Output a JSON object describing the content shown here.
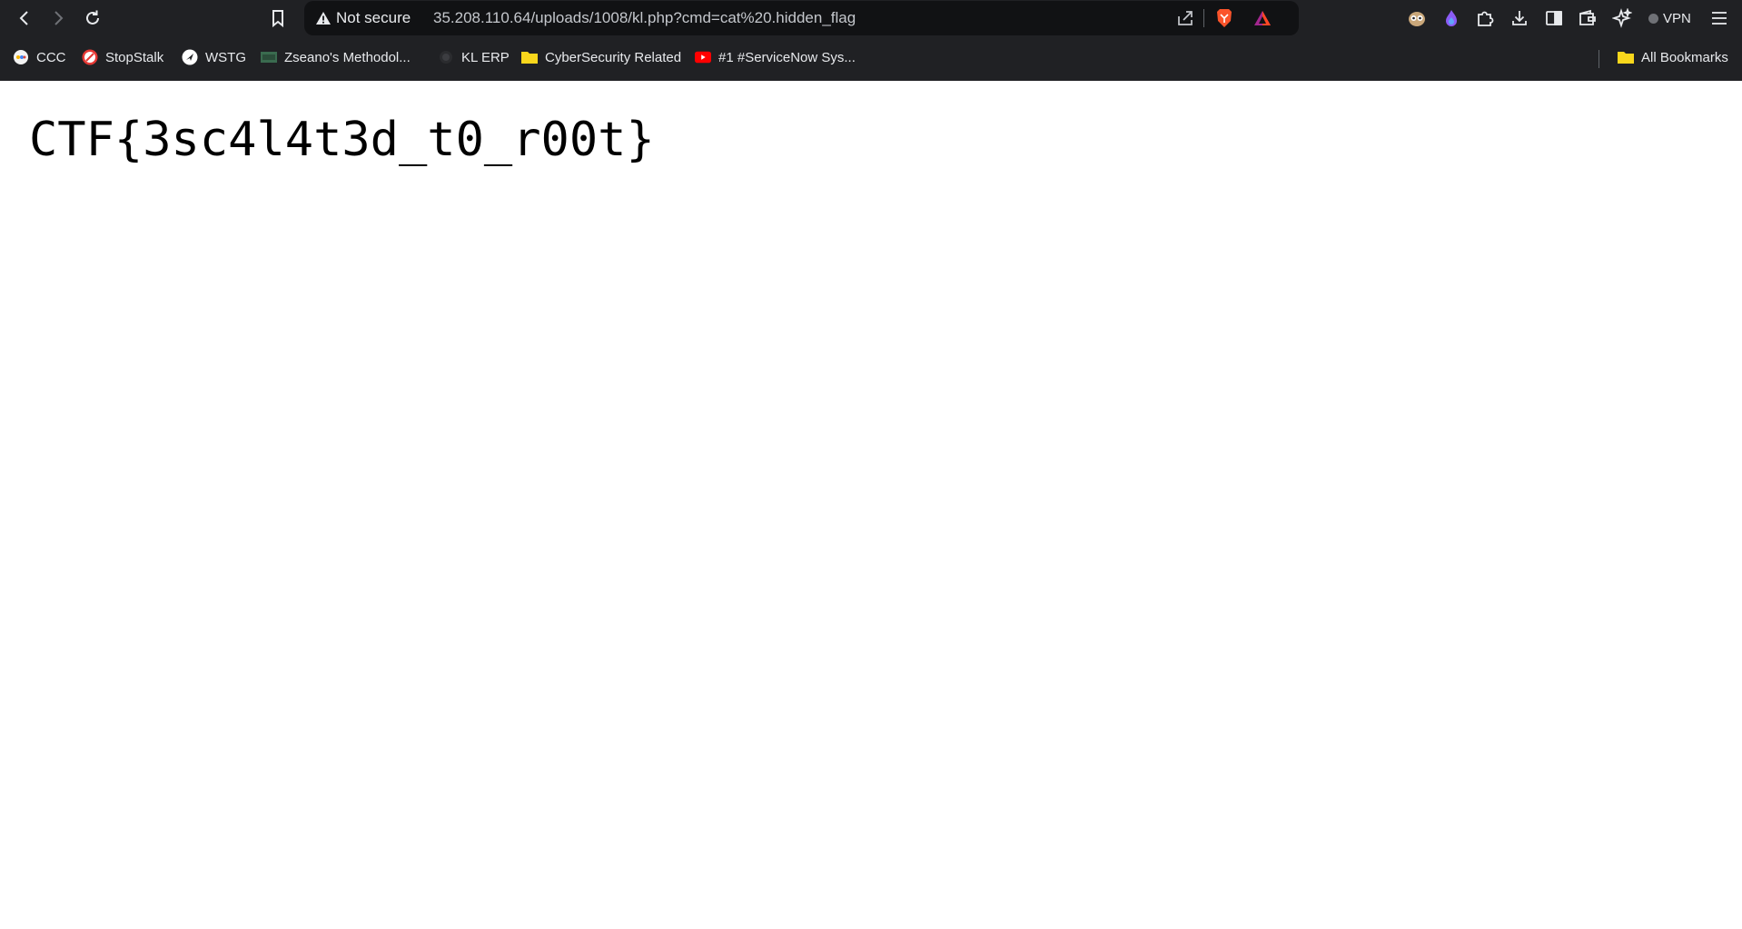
{
  "toolbar": {
    "back_icon": "chevron-left-icon",
    "forward_icon": "chevron-right-icon",
    "reload_icon": "reload-icon",
    "bookmark_icon": "bookmark-icon"
  },
  "address_bar": {
    "security_label": "Not secure",
    "url": "35.208.110.64/uploads/1008/kl.php?cmd=cat%20.hidden_flag",
    "share_icon": "share-icon",
    "brave_shield_icon": "brave-shield-icon",
    "brave_rewards_icon": "brave-rewards-icon"
  },
  "right_toolbar": {
    "vpn_label": "VPN"
  },
  "bookmarks": [
    {
      "label": "CCC"
    },
    {
      "label": "StopStalk"
    },
    {
      "label": "WSTG"
    },
    {
      "label": "Zseano's Methodol..."
    },
    {
      "label": "KL ERP"
    },
    {
      "label": "CyberSecurity Related"
    },
    {
      "label": "#1 #ServiceNow Sys..."
    }
  ],
  "all_bookmarks_label": "All Bookmarks",
  "page": {
    "text": "CTF{3sc4l4t3d_t0_r00t}"
  }
}
